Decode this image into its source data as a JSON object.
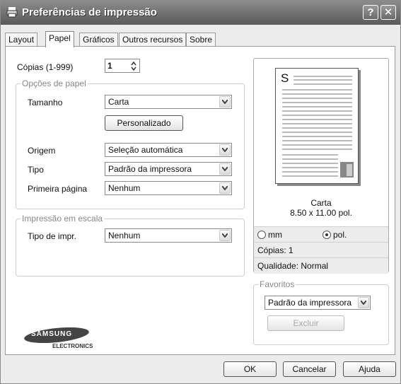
{
  "window": {
    "title": "Preferências de impressão",
    "help_btn": "?",
    "close_btn": "✕"
  },
  "tabs": [
    {
      "label": "Layout"
    },
    {
      "label": "Papel"
    },
    {
      "label": "Gráficos"
    },
    {
      "label": "Outros recursos"
    },
    {
      "label": "Sobre"
    }
  ],
  "copies": {
    "label": "Cópias (1-999)",
    "value": "1"
  },
  "paper_options": {
    "legend": "Opções de papel",
    "size_label": "Tamanho",
    "size_value": "Carta",
    "custom_button": "Personalizado",
    "source_label": "Origem",
    "source_value": "Seleção automática",
    "type_label": "Tipo",
    "type_value": "Padrão da impressora",
    "first_page_label": "Primeira página",
    "first_page_value": "Nenhum"
  },
  "scaling": {
    "legend": "Impressão em escala",
    "type_label": "Tipo de impr.",
    "type_value": "Nenhum"
  },
  "preview": {
    "page_letter": "S",
    "paper_name": "Carta",
    "paper_size": "8.50 x 11.00 pol.",
    "unit_mm": "mm",
    "unit_pol": "pol.",
    "copies_info": "Cópias: 1",
    "quality_info": "Qualidade: Normal"
  },
  "favorites": {
    "legend": "Favoritos",
    "value": "Padrão da impressora",
    "delete_button": "Excluir"
  },
  "logo": {
    "brand": "SAMSUNG",
    "sub": "ELECTRONICS"
  },
  "buttons": {
    "ok": "OK",
    "cancel": "Cancelar",
    "help": "Ajuda"
  },
  "colors": {
    "titlebar": "#6a6a6a",
    "panel": "#ffffff",
    "background": "#ececec"
  }
}
